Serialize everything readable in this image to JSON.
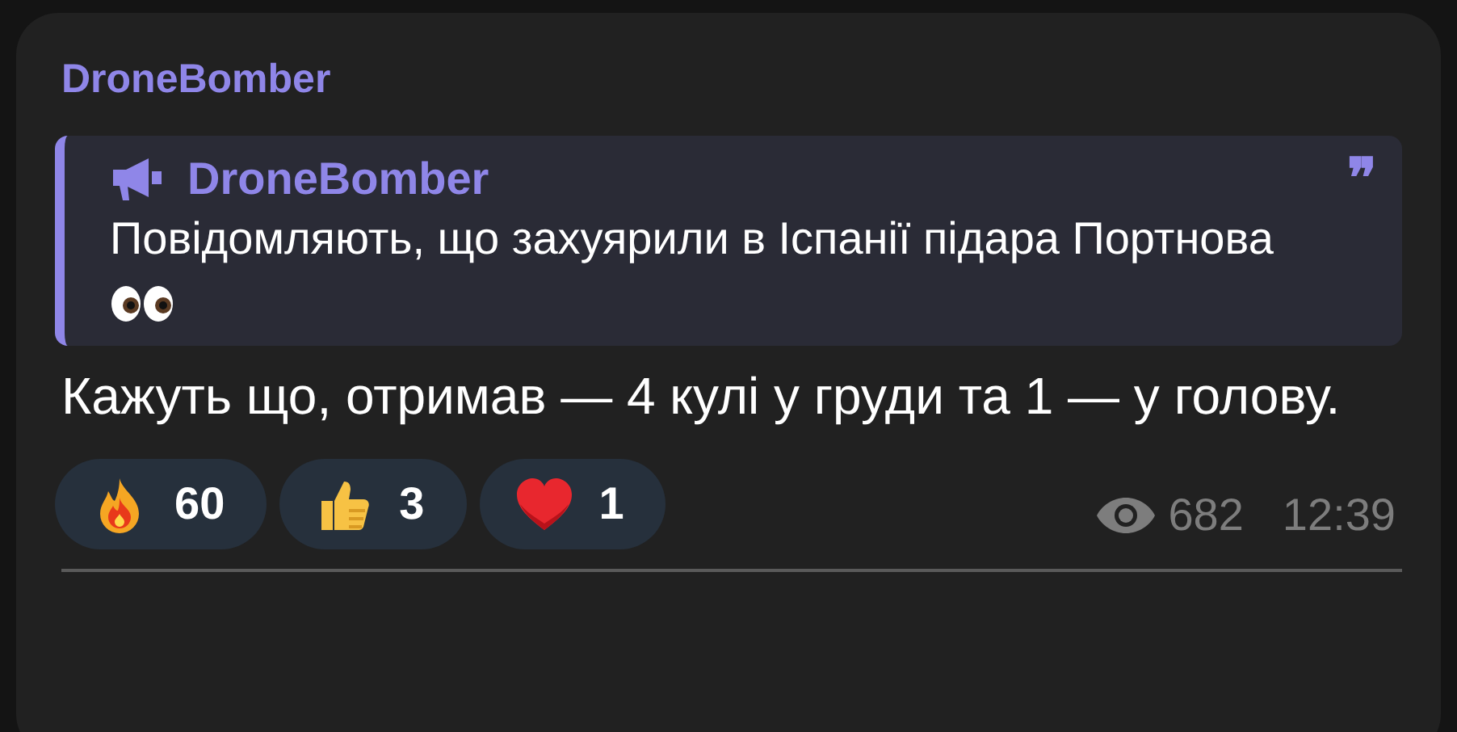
{
  "message": {
    "author": "DroneBomber",
    "quote": {
      "author": "DroneBomber",
      "mark": "❞",
      "text": "Повідомляють, що захуярили в Іспанії підара Портнова"
    },
    "text": "Кажуть що, отримав — 4 кулі у груди та 1 — у голову.",
    "reactions": [
      {
        "kind": "fire",
        "count": "60"
      },
      {
        "kind": "thumbs",
        "count": "3"
      },
      {
        "kind": "heart",
        "count": "1"
      }
    ],
    "views": "682",
    "time": "12:39"
  }
}
